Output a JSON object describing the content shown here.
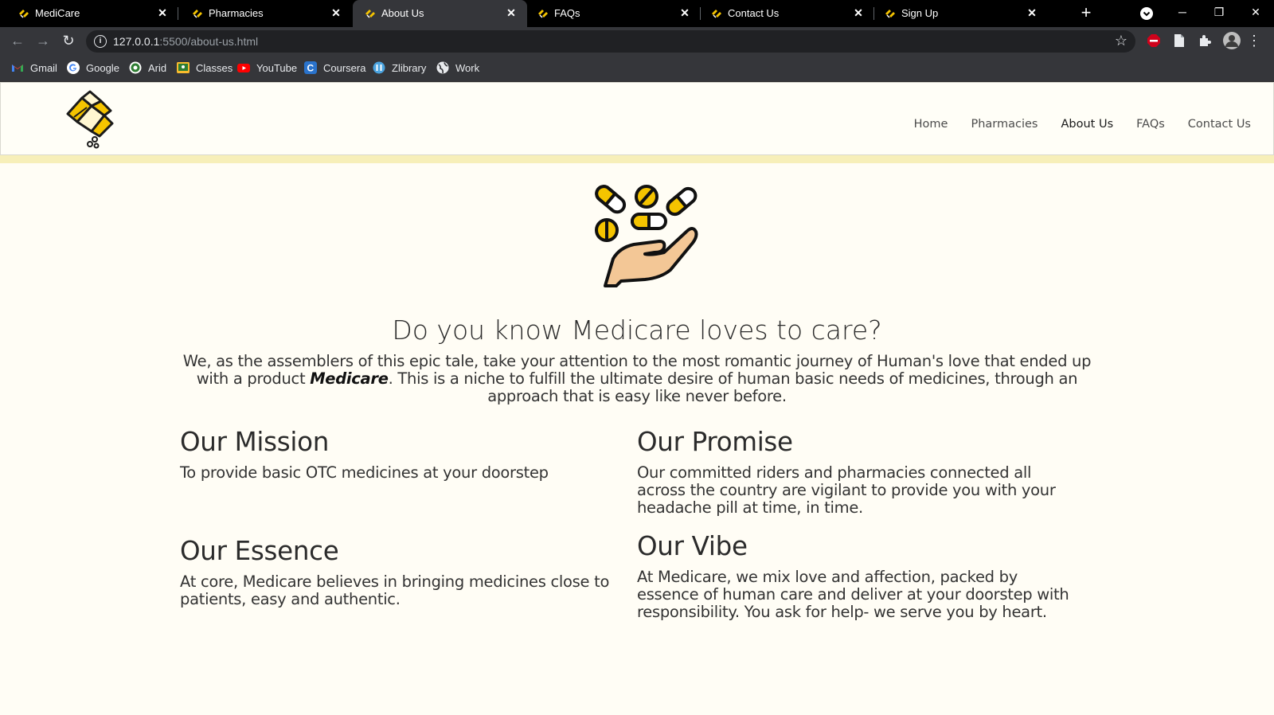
{
  "browser": {
    "tabs": [
      {
        "title": "MediCare",
        "active": false
      },
      {
        "title": "Pharmacies",
        "active": false
      },
      {
        "title": "About Us",
        "active": true
      },
      {
        "title": "FAQs",
        "active": false
      },
      {
        "title": "Contact Us",
        "active": false
      },
      {
        "title": "Sign Up",
        "active": false
      }
    ],
    "url_host": "127.0.0.1",
    "url_rest": ":5500/about-us.html",
    "bookmarks": [
      {
        "label": "Gmail",
        "icon": "gmail-icon",
        "color": "#ea4335"
      },
      {
        "label": "Google",
        "icon": "google-icon",
        "color": "#ffffff"
      },
      {
        "label": "Arid",
        "icon": "arid-icon",
        "color": "#34a853"
      },
      {
        "label": "Classes",
        "icon": "classroom-icon",
        "color": "#f9bb2d"
      },
      {
        "label": "YouTube",
        "icon": "youtube-icon",
        "color": "#ff0000"
      },
      {
        "label": "Coursera",
        "icon": "coursera-icon",
        "color": "#2a73cc"
      },
      {
        "label": "Zlibrary",
        "icon": "zlibrary-icon",
        "color": "#4aa3df"
      },
      {
        "label": "Work",
        "icon": "globe-icon",
        "color": "#e8eaed"
      }
    ]
  },
  "site": {
    "nav": [
      {
        "label": "Home",
        "current": false
      },
      {
        "label": "Pharmacies",
        "current": false
      },
      {
        "label": "About Us",
        "current": true
      },
      {
        "label": "FAQs",
        "current": false
      },
      {
        "label": "Contact Us",
        "current": false
      }
    ],
    "heading": "Do you know Medicare loves to care?",
    "lead_before": "We, as the assemblers of this epic tale, take your attention to the most romantic journey of Human's love that ended up with a product ",
    "lead_brand": "Medicare",
    "lead_after": ". This is a niche to fulfill the ultimate desire of human basic needs of medicines, through an approach that is easy like never before.",
    "sections": {
      "mission": {
        "title": "Our Mission",
        "text": "To provide basic OTC medicines at your doorstep"
      },
      "promise": {
        "title": "Our Promise",
        "text": "Our committed riders and pharmacies connected all across the country are vigilant to provide you with your headache pill at time, in time."
      },
      "essence": {
        "title": "Our Essence",
        "text": "At core, Medicare believes in bringing medicines close to patients, easy and authentic."
      },
      "vibe": {
        "title": "Our Vibe",
        "text": "At Medicare, we mix love and affection, packed by essence of human care and deliver at your doorstep with responsibility. You ask for help- we serve you by heart."
      }
    }
  },
  "colors": {
    "accent_yellow": "#f5c400",
    "page_bg": "#fffdf5",
    "strip": "#f7efb9"
  }
}
